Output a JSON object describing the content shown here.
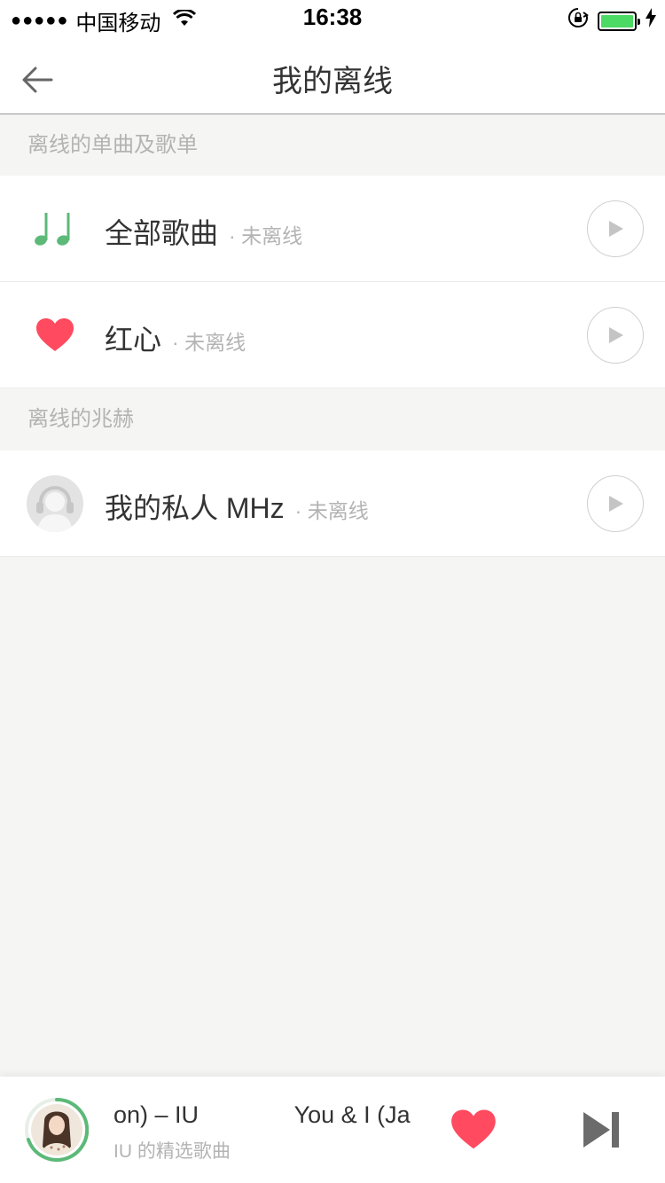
{
  "status_bar": {
    "signal_dots": "●●●●●",
    "carrier": "中国移动",
    "time": "16:38"
  },
  "nav": {
    "title": "我的离线"
  },
  "sections": [
    {
      "header": "离线的单曲及歌单",
      "items": [
        {
          "title": "全部歌曲",
          "status": "· 未离线",
          "icon": "music-notes-icon"
        },
        {
          "title": "红心",
          "status": "· 未离线",
          "icon": "heart-icon"
        }
      ]
    },
    {
      "header": "离线的兆赫",
      "items": [
        {
          "title": "我的私人 MHz",
          "status": "· 未离线",
          "icon": "headphones-avatar-icon"
        }
      ]
    }
  ],
  "player": {
    "song_title_a": "on) – IU",
    "song_title_b": "You & I (Ja",
    "subtitle": "IU 的精选歌曲"
  },
  "colors": {
    "accent_green": "#5cb978",
    "heart_red": "#ff4a5f",
    "battery_green": "#4cd964"
  }
}
